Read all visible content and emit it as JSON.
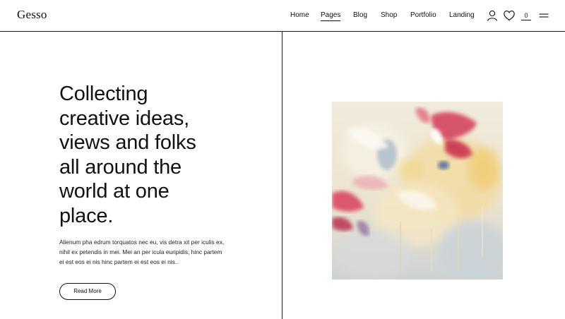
{
  "header": {
    "logo": "Gesso",
    "nav": [
      {
        "label": "Home",
        "active": false
      },
      {
        "label": "Pages",
        "active": true
      },
      {
        "label": "Blog",
        "active": false
      },
      {
        "label": "Shop",
        "active": false
      },
      {
        "label": "Portfolio",
        "active": false
      },
      {
        "label": "Landing",
        "active": false
      }
    ],
    "icons": [
      "user-icon",
      "heart-icon",
      "menu-icon"
    ],
    "cart_count": "0"
  },
  "hero": {
    "headline_lines": [
      "Collecting",
      "creative ideas,",
      "views and folks",
      "all around the",
      "world at one",
      "place."
    ],
    "body_lines": [
      "Alienum pha edrum torquatos nec eu, vis detra xit per iculis ex,",
      "nihil ex petendis in mei. Mei an per icula euripidis, hinc partem",
      "ei est eos ei nis hinc partem ei est eos ei nis.."
    ],
    "button_label": "Read More"
  },
  "colors": {
    "text": "#111111",
    "background": "#ffffff",
    "rule": "#1a1a1a"
  }
}
